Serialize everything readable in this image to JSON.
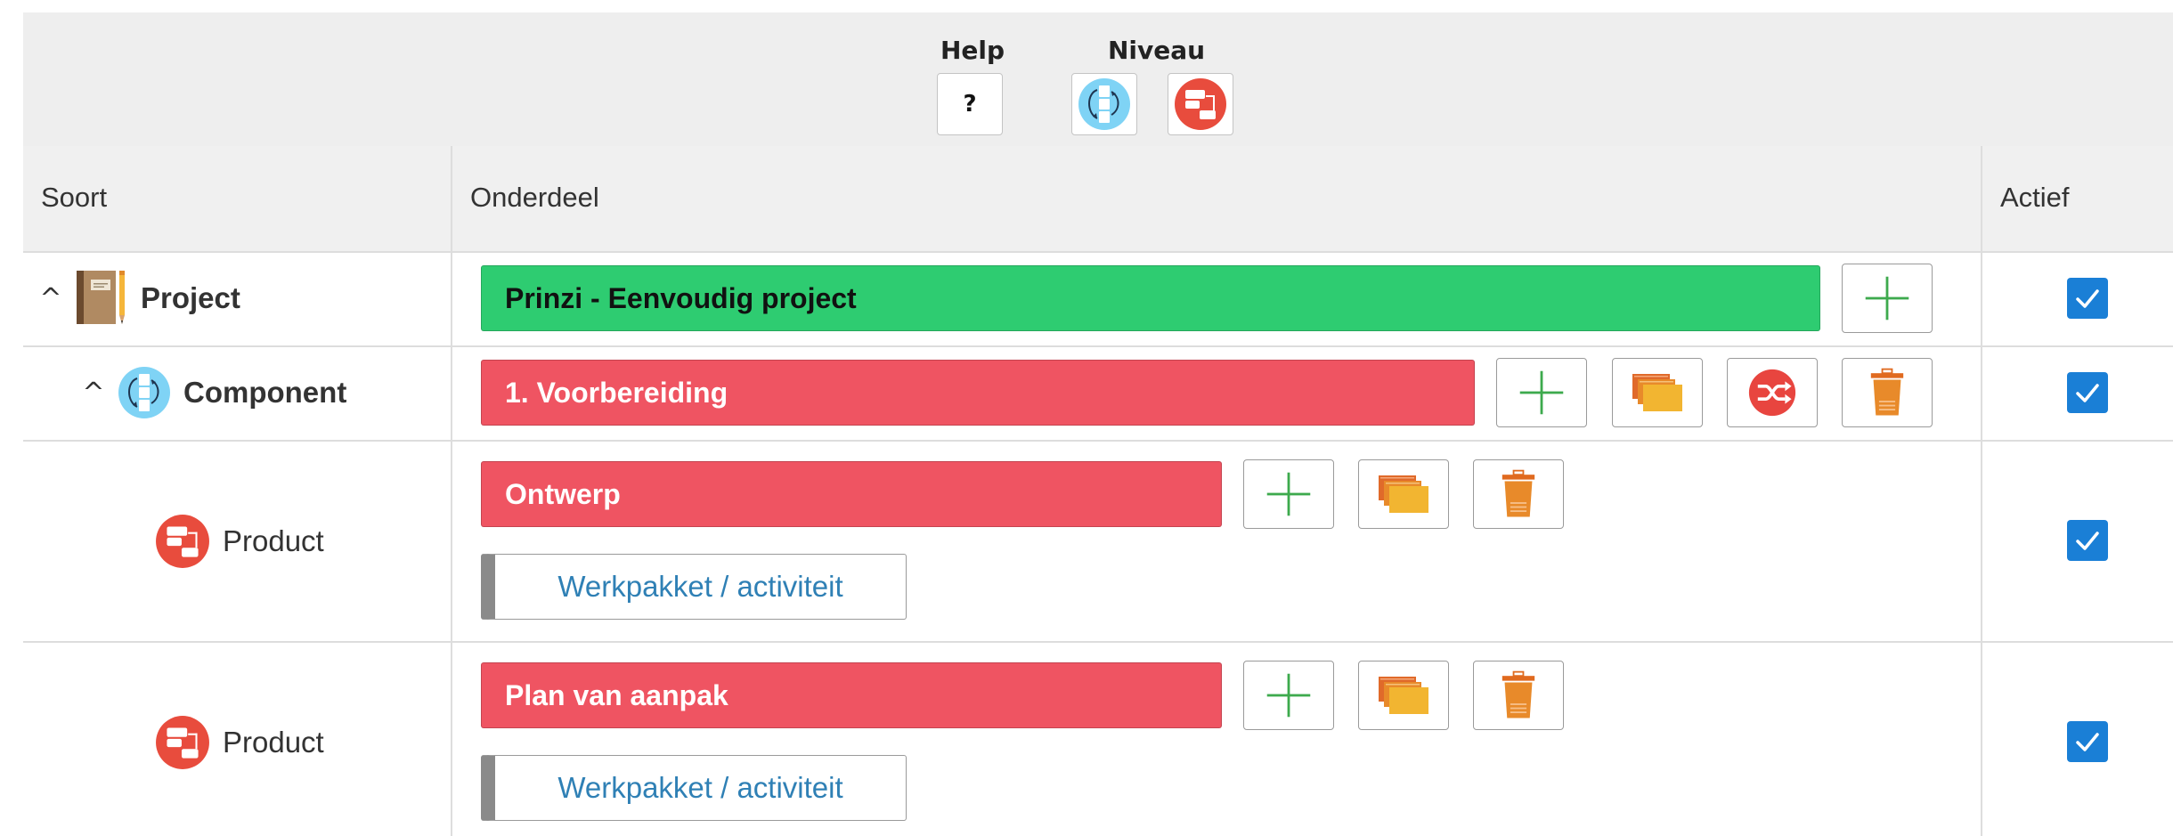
{
  "toolbar": {
    "help_label": "Help",
    "help_button": "?",
    "niveau_label": "Niveau",
    "niveau_icons": [
      "component-level-icon",
      "product-level-icon"
    ]
  },
  "table": {
    "headers": {
      "soort": "Soort",
      "onderdeel": "Onderdeel",
      "actief": "Actief"
    }
  },
  "rows": [
    {
      "soort": "Project",
      "onderdeel": "Prinzi - Eenvoudig project",
      "actief": true,
      "color": "#2ecc71"
    },
    {
      "soort": "Component",
      "onderdeel": "1. Voorbereiding",
      "actief": true,
      "color": "#ef5462"
    },
    {
      "soort": "Product",
      "onderdeel": "Ontwerp",
      "sub_action": "Werkpakket / activiteit",
      "actief": true,
      "color": "#ef5462"
    },
    {
      "soort": "Product",
      "onderdeel": "Plan van aanpak",
      "sub_action": "Werkpakket / activiteit",
      "actief": true,
      "color": "#ef5462"
    }
  ],
  "colors": {
    "toolbar_bg": "#eeeeee",
    "checkbox": "#1a7fd6",
    "add_icon": "#3daa4d",
    "link_text": "#2f80b5"
  },
  "icons": {
    "collapse": "chevron-up-icon",
    "project": "notebook-icon",
    "component": "component-icon",
    "product": "product-icon",
    "add": "plus-icon",
    "copy": "copy-icon",
    "convert": "shuffle-icon",
    "delete": "trash-icon"
  }
}
